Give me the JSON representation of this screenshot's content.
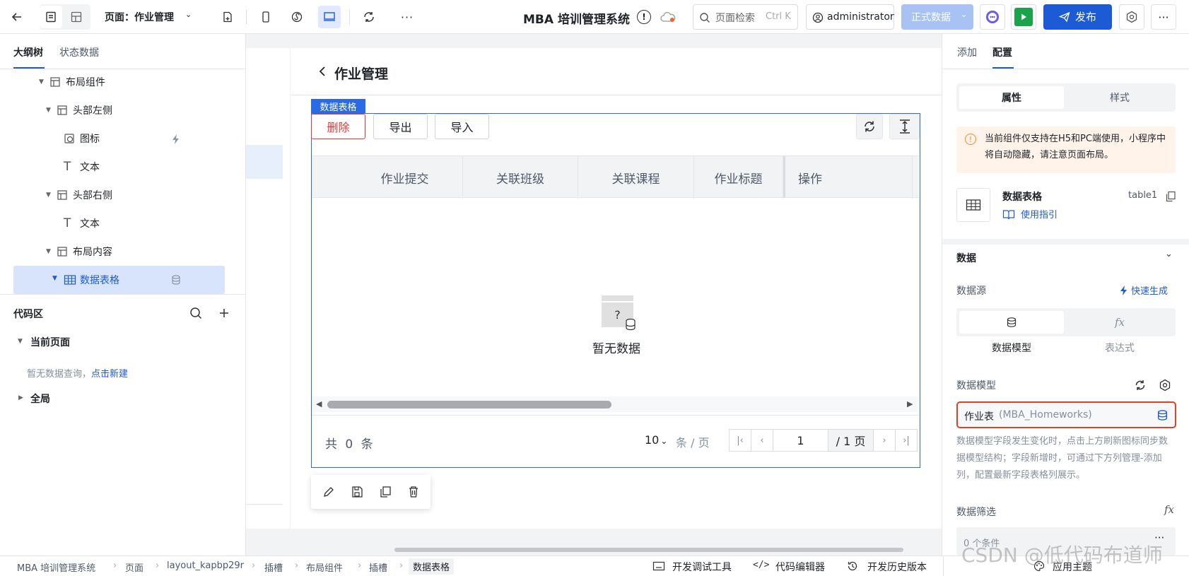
{
  "topbar": {
    "page_label": "页面：作业管理",
    "app_title": "MBA 培训管理系统",
    "search_placeholder": "页面检索",
    "search_shortcut": "Ctrl K",
    "user": "administrator",
    "env": "正式数据",
    "publish": "发布"
  },
  "left": {
    "tab_outline": "大纲树",
    "tab_state": "状态数据",
    "tree": [
      {
        "label": "布局组件"
      },
      {
        "label": "头部左侧"
      },
      {
        "label": "图标"
      },
      {
        "label": "文本"
      },
      {
        "label": "头部右侧"
      },
      {
        "label": "文本"
      },
      {
        "label": "布局内容"
      },
      {
        "label": "数据表格"
      }
    ],
    "code_area": "代码区",
    "current_page": "当前页面",
    "no_query": "暂无数据查询，",
    "create_new": "点击新建",
    "global": "全局"
  },
  "canvas": {
    "page_title": "作业管理",
    "selected_tag": "数据表格",
    "actions": {
      "delete": "删除",
      "export": "导出",
      "import": "导入"
    },
    "columns": [
      "作业提交",
      "关联班级",
      "关联课程",
      "作业标题",
      "操作"
    ],
    "empty_text": "暂无数据",
    "empty_glyph": "?",
    "pagination": {
      "total_prefix": "共",
      "total": "0",
      "total_suffix": "条",
      "page_size": "10",
      "per_page": "条 / 页",
      "current": "1",
      "pages": "/ 1 页"
    }
  },
  "right": {
    "tab_add": "添加",
    "tab_config": "配置",
    "seg_props": "属性",
    "seg_style": "样式",
    "notice": "当前组件仅支持在H5和PC端使用，小程序中将自动隐藏，请注意页面布局。",
    "component_name": "数据表格",
    "component_id": "table1",
    "guide": "使用指引",
    "data_section": "数据",
    "datasource": "数据源",
    "quick_gen": "快速生成",
    "ds_model": "数据模型",
    "ds_expr": "表达式",
    "model_label": "数据模型",
    "model_name": "作业表",
    "model_id": "(MBA_Homeworks)",
    "model_hint": "数据模型字段发生变化时，点击上方刷新图标同步数据模型结构；字段新增时，可通过下方列管理-添加列，配置最新字段表格列展示。",
    "filter_label": "数据筛选",
    "filter_value": "0 个条件"
  },
  "statusbar": {
    "breadcrumbs": [
      "MBA 培训管理系统",
      "页面",
      "layout_kapbp29r",
      "插槽",
      "布局组件",
      "插槽",
      "数据表格"
    ],
    "debug_tool": "开发调试工具",
    "code_editor": "代码编辑器",
    "history": "开发历史版本",
    "theme": "应用主题"
  },
  "watermark": "CSDN @低代码布道师",
  "colors": {
    "accent": "#1d5ad6",
    "danger": "#e5383b",
    "selection": "#2b6ae6",
    "env": "#a7c2f3",
    "run": "#1aa34a"
  }
}
